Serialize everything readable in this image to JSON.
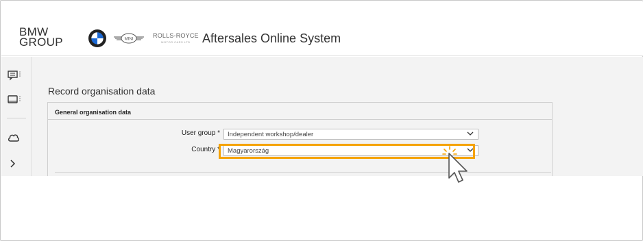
{
  "header": {
    "brand_line1": "BMW",
    "brand_line2": "GROUP",
    "rr_name": "ROLLS-ROYCE",
    "rr_sub": "MOTOR CARS LTD",
    "mini_text": "MINI",
    "title": "Aftersales Online System"
  },
  "sidebar": {
    "items": [
      {
        "icon": "chat-list-icon"
      },
      {
        "icon": "monitor-icon"
      },
      {
        "icon": "cloud-icon"
      },
      {
        "icon": "chevron-right-icon"
      }
    ]
  },
  "main": {
    "section_title": "Record organisation data",
    "panel_title": "General organisation data",
    "fields": {
      "user_group": {
        "label": "User group",
        "required_mark": "*",
        "value": "Independent workshop/dealer"
      },
      "country": {
        "label": "Country",
        "required_mark": "*",
        "value": "Magyarország"
      }
    }
  },
  "colors": {
    "highlight": "#f5a200",
    "background": "#f3f3f3"
  }
}
